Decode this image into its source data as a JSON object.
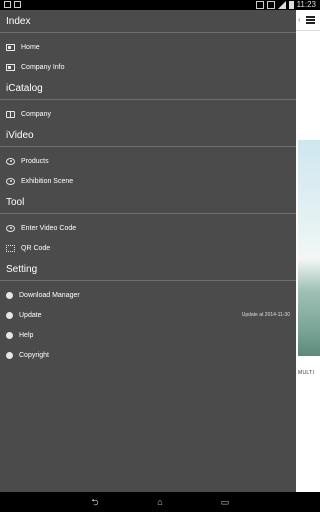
{
  "status_bar": {
    "time": "11:23"
  },
  "drawer": {
    "sections": [
      {
        "title": "Index",
        "items": [
          {
            "label": "Home",
            "icon": "card-icon"
          },
          {
            "label": "Company Info",
            "icon": "card-icon"
          }
        ]
      },
      {
        "title": "iCatalog",
        "items": [
          {
            "label": "Company",
            "icon": "book-icon"
          }
        ]
      },
      {
        "title": "iVideo",
        "items": [
          {
            "label": "Products",
            "icon": "eye-icon"
          },
          {
            "label": "Exhibition Scene",
            "icon": "eye-icon"
          }
        ]
      },
      {
        "title": "Tool",
        "items": [
          {
            "label": "Enter Video Code",
            "icon": "eye-icon"
          },
          {
            "label": "QR Code",
            "icon": "qr-code-icon"
          }
        ]
      },
      {
        "title": "Setting",
        "items": [
          {
            "label": "Download Manager",
            "icon": "circle-icon"
          },
          {
            "label": "Update",
            "icon": "circle-icon",
            "note": "Update at 2014-11-30"
          },
          {
            "label": "Help",
            "icon": "circle-icon"
          },
          {
            "label": "Copyright",
            "icon": "circle-icon"
          }
        ]
      }
    ]
  },
  "peek": {
    "text": "MULTI"
  },
  "navbar": {
    "back": "⮌",
    "home": "⌂",
    "recent": "▭"
  }
}
